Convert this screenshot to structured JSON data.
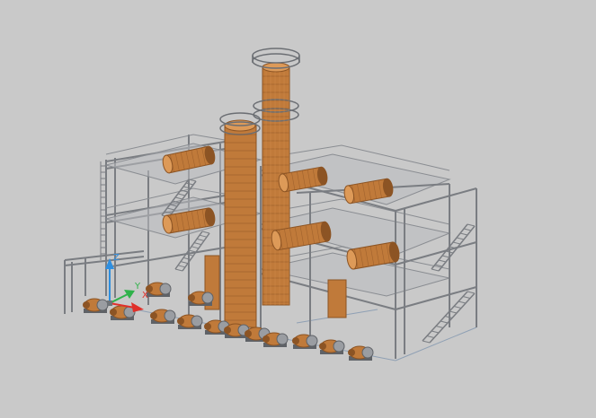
{
  "viewport": {
    "background": "#c9c9c9"
  },
  "colors": {
    "steel": "#7a7d82",
    "steel_dark": "#5f6267",
    "steel_light": "#9a9da2",
    "vessel": "#c07a3a",
    "vessel_dark": "#8c5424",
    "vessel_light": "#dd9a58",
    "deck": "#b9bcc0",
    "ucs_x": "#e0302a",
    "ucs_y": "#2fb24a",
    "ucs_z": "#2f8fe0"
  },
  "ucs": {
    "x_label": "X",
    "y_label": "Y",
    "z_label": "Z",
    "icon": "ucs-axis-icon"
  },
  "model": {
    "type": "3d-wireframe-plant",
    "description_icon": "process-plant-model"
  }
}
